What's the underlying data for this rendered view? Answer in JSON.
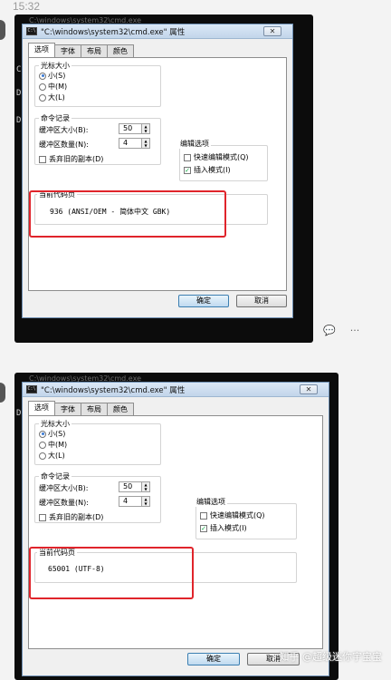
{
  "chat": {
    "timestamp": "15:32",
    "actions": [
      "comment",
      "more"
    ],
    "watermark": "知乎 @超级迷你宇宝宝"
  },
  "screenshots": [
    {
      "bg_title": "C:\\windows\\system32\\cmd.exe",
      "dialog": {
        "title": "\"C:\\windows\\system32\\cmd.exe\" 属性",
        "close_glyph": "✕",
        "tabs": [
          "选项",
          "字体",
          "布局",
          "颜色"
        ],
        "cursor_size_label": "光标大小",
        "cursor_options": [
          "小(S)",
          "中(M)",
          "大(L)"
        ],
        "history_label": "命令记录",
        "buffer_size_label": "缓冲区大小(B):",
        "buffer_size_value": "50",
        "buffer_count_label": "缓冲区数量(N):",
        "buffer_count_value": "4",
        "discard_dup_label": "丢弃旧的副本(D)",
        "edit_options_label": "编辑选项",
        "quick_edit_label": "快速编辑模式(Q)",
        "insert_mode_label": "插入模式(I)",
        "codepage_label": "当前代码页",
        "codepage_value": "936   (ANSI/OEM - 简体中文 GBK)",
        "ok_label": "确定",
        "cancel_label": "取消"
      }
    },
    {
      "bg_title": "C:\\windows\\system32\\cmd.exe",
      "dialog": {
        "title": "\"C:\\windows\\system32\\cmd.exe\" 属性",
        "close_glyph": "✕",
        "tabs": [
          "选项",
          "字体",
          "布局",
          "颜色"
        ],
        "cursor_size_label": "光标大小",
        "cursor_options": [
          "小(S)",
          "中(M)",
          "大(L)"
        ],
        "history_label": "命令记录",
        "buffer_size_label": "缓冲区大小(B):",
        "buffer_size_value": "50",
        "buffer_count_label": "缓冲区数量(N):",
        "buffer_count_value": "4",
        "discard_dup_label": "丢弃旧的副本(D)",
        "edit_options_label": "编辑选项",
        "quick_edit_label": "快速编辑模式(Q)",
        "insert_mode_label": "插入模式(I)",
        "codepage_label": "当前代码页",
        "codepage_value": "65001  (UTF-8)",
        "ok_label": "确定",
        "cancel_label": "取消"
      }
    }
  ],
  "colors": {
    "highlight": "#e0242b",
    "ok_button": "#c0daf0"
  }
}
